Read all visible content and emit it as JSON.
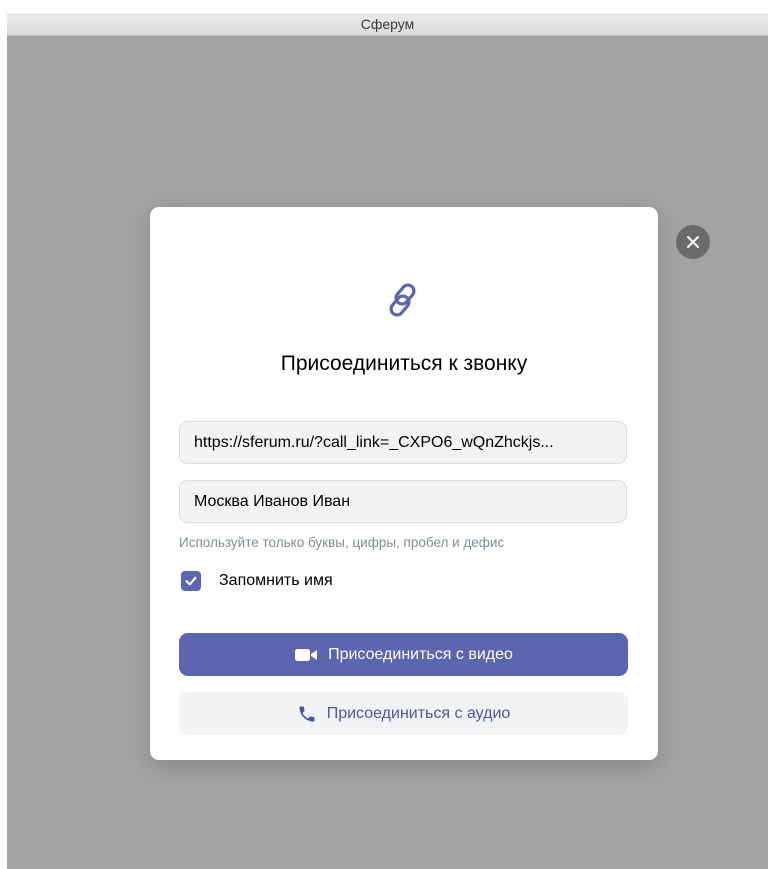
{
  "window": {
    "title": "Сферум"
  },
  "modal": {
    "title": "Присоединиться к звонку",
    "url_field": {
      "value": "https://sferum.ru/?call_link=_CXPO6_wQnZhckjs..."
    },
    "name_field": {
      "value": "Москва Иванов Иван"
    },
    "hint": "Используйте только буквы, цифры, пробел и дефис",
    "remember": {
      "label": "Запомнить имя",
      "checked": true
    },
    "video_button": {
      "label": "Присоединиться с видео",
      "icon": "video-camera-icon"
    },
    "audio_button": {
      "label": "Присоединиться с аудио",
      "icon": "phone-icon"
    }
  },
  "icons": {
    "header": "link-icon",
    "close": "close-icon",
    "checkbox": "checkmark-icon"
  },
  "colors": {
    "accent": "#5b65b0",
    "accent_text": "#4b56a6",
    "hint": "#818c99",
    "backdrop": "#a3a3a3"
  }
}
